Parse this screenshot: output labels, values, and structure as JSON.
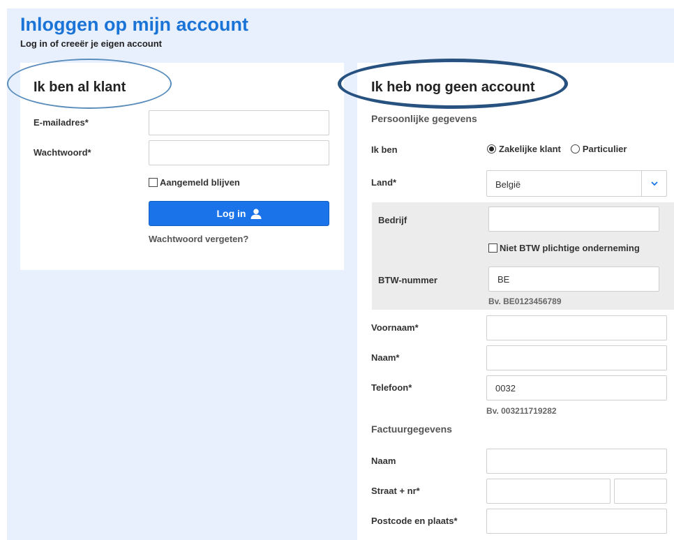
{
  "header": {
    "title": "Inloggen op mijn account",
    "subtitle": "Log in of creeër je eigen account"
  },
  "login": {
    "heading": "Ik ben al klant",
    "email_label": "E-mailadres*",
    "email_value": "",
    "password_label": "Wachtwoord*",
    "password_value": "",
    "remember_label": "Aangemeld blijven",
    "login_button": "Log in",
    "forgot_link": "Wachtwoord vergeten?"
  },
  "register": {
    "heading": "Ik heb nog geen account",
    "personal_section": "Persoonlijke gegevens",
    "ik_ben_label": "Ik ben",
    "option_business": "Zakelijke klant",
    "option_private": "Particulier",
    "selected_option": "Zakelijke klant",
    "land_label": "Land*",
    "land_value": "België",
    "company_label": "Bedrijf",
    "company_value": "",
    "no_vat_label": "Niet BTW plichtige onderneming",
    "vat_label": "BTW-nummer",
    "vat_value": "BE",
    "vat_hint": "Bv. BE0123456789",
    "firstname_label": "Voornaam*",
    "firstname_value": "",
    "lastname_label": "Naam*",
    "lastname_value": "",
    "phone_label": "Telefoon*",
    "phone_value": "0032",
    "phone_hint": "Bv. 003211719282",
    "billing_section": "Factuurgegevens",
    "billing_name_label": "Naam",
    "billing_name_value": "",
    "street_label": "Straat + nr*",
    "street_value": "",
    "number_value": "",
    "postcode_label": "Postcode en plaats*",
    "postcode_value": ""
  },
  "colors": {
    "accent": "#1a73e8",
    "title": "#1a73d6",
    "background_panel": "#e8f0fd",
    "company_box": "#ececec",
    "ellipse_left": "#5a8dbb",
    "ellipse_right": "#27517f"
  },
  "icons": {
    "login_button_icon": "user-icon",
    "select_arrow_icon": "chevron-down-icon"
  }
}
